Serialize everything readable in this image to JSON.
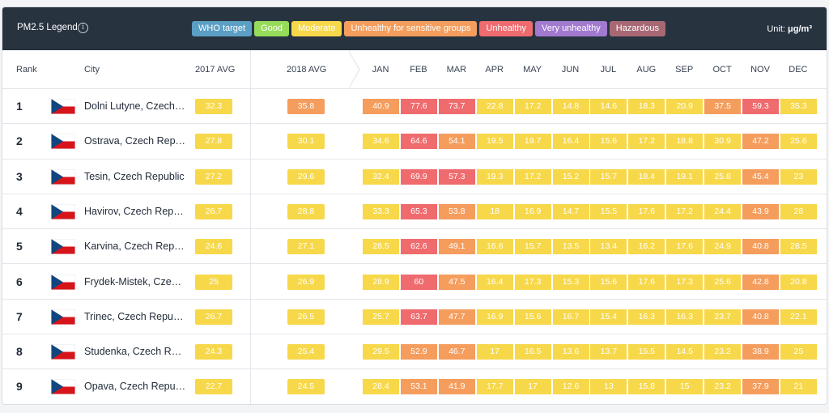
{
  "legend": {
    "title": "PM2.5 Legend",
    "info_icon": "info-icon",
    "unit_prefix": "Unit: ",
    "unit": "μg/m³",
    "items": [
      {
        "label": "WHO target",
        "color": "#5b9fc5"
      },
      {
        "label": "Good",
        "color": "#96dc5a"
      },
      {
        "label": "Moderate",
        "color": "#f7d84a"
      },
      {
        "label": "Unhealthy for sensitive groups",
        "color": "#f59d5d"
      },
      {
        "label": "Unhealthy",
        "color": "#ef6b6e"
      },
      {
        "label": "Very unhealthy",
        "color": "#a17ad0"
      },
      {
        "label": "Hazardous",
        "color": "#a76874"
      }
    ]
  },
  "table": {
    "headers": {
      "rank": "Rank",
      "city": "City",
      "avg2017": "2017 AVG",
      "avg2018": "2018 AVG",
      "months": [
        "JAN",
        "FEB",
        "MAR",
        "APR",
        "MAY",
        "JUN",
        "JUL",
        "AUG",
        "SEP",
        "OCT",
        "NOV",
        "DEC"
      ]
    },
    "rows": [
      {
        "rank": "1",
        "city": "Dolni Lutyne, Czech Republic",
        "flag": "czech-flag-icon",
        "avg2017": "32.3",
        "avg2018": "35.8",
        "months": [
          "40.9",
          "77.6",
          "73.7",
          "22.8",
          "17.2",
          "14.8",
          "14.6",
          "18.3",
          "20.9",
          "37.5",
          "59.3",
          "35.3"
        ]
      },
      {
        "rank": "2",
        "city": "Ostrava, Czech Republic",
        "flag": "czech-flag-icon",
        "avg2017": "27.8",
        "avg2018": "30.1",
        "months": [
          "34.6",
          "64.6",
          "54.1",
          "19.5",
          "19.7",
          "16.4",
          "15.6",
          "17.2",
          "18.8",
          "30.9",
          "47.2",
          "25.6"
        ]
      },
      {
        "rank": "3",
        "city": "Tesin, Czech Republic",
        "flag": "czech-flag-icon",
        "avg2017": "27.2",
        "avg2018": "29.6",
        "months": [
          "32.4",
          "69.9",
          "57.3",
          "19.3",
          "17.2",
          "15.2",
          "15.7",
          "18.4",
          "19.1",
          "25.8",
          "45.4",
          "23"
        ]
      },
      {
        "rank": "4",
        "city": "Havirov, Czech Republic",
        "flag": "czech-flag-icon",
        "avg2017": "26.7",
        "avg2018": "28.8",
        "months": [
          "33.3",
          "65.3",
          "53.8",
          "18",
          "16.9",
          "14.7",
          "15.5",
          "17.6",
          "17.2",
          "24.4",
          "43.9",
          "28"
        ]
      },
      {
        "rank": "5",
        "city": "Karvina, Czech Republic",
        "flag": "czech-flag-icon",
        "avg2017": "24.6",
        "avg2018": "27.1",
        "months": [
          "28.5",
          "62.6",
          "49.1",
          "16.6",
          "15.7",
          "13.5",
          "13.4",
          "16.2",
          "17.6",
          "24.9",
          "40.8",
          "28.5"
        ]
      },
      {
        "rank": "6",
        "city": "Frydek-Mistek, Czech Republic",
        "flag": "czech-flag-icon",
        "avg2017": "25",
        "avg2018": "26.9",
        "months": [
          "28.9",
          "60",
          "47.5",
          "16.4",
          "17.3",
          "15.3",
          "15.6",
          "17.6",
          "17.3",
          "25.6",
          "42.8",
          "20.8"
        ]
      },
      {
        "rank": "7",
        "city": "Trinec, Czech Republic",
        "flag": "czech-flag-icon",
        "avg2017": "26.7",
        "avg2018": "26.5",
        "months": [
          "25.7",
          "63.7",
          "47.7",
          "16.9",
          "15.6",
          "16.7",
          "15.4",
          "16.3",
          "16.3",
          "23.7",
          "40.8",
          "22.1"
        ]
      },
      {
        "rank": "8",
        "city": "Studenka, Czech Republic",
        "flag": "czech-flag-icon",
        "avg2017": "24.3",
        "avg2018": "25.4",
        "months": [
          "29.5",
          "52.9",
          "46.7",
          "17",
          "16.5",
          "13.6",
          "13.7",
          "15.5",
          "14.5",
          "23.2",
          "38.9",
          "25"
        ]
      },
      {
        "rank": "9",
        "city": "Opava, Czech Republic",
        "flag": "czech-flag-icon",
        "avg2017": "22.7",
        "avg2018": "24.5",
        "months": [
          "28.4",
          "53.1",
          "41.9",
          "17.7",
          "17",
          "12.6",
          "13",
          "15.8",
          "15",
          "23.2",
          "37.9",
          "21"
        ]
      }
    ]
  }
}
